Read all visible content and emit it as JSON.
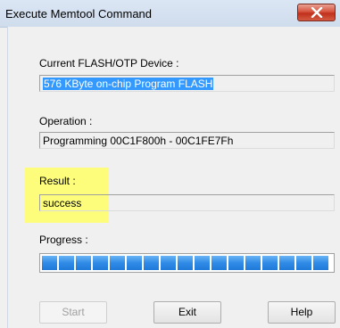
{
  "window": {
    "title": "Execute Memtool Command"
  },
  "device": {
    "label": "Current FLASH/OTP Device :",
    "value": "576 KByte on-chip Program FLASH"
  },
  "operation": {
    "label": "Operation :",
    "value": "Programming 00C1F800h - 00C1FE7Fh"
  },
  "result": {
    "label": "Result :",
    "value": "success"
  },
  "progress": {
    "label": "Progress :",
    "percent": 100,
    "segments": 17
  },
  "buttons": {
    "start": "Start",
    "exit": "Exit",
    "help": "Help"
  },
  "colors": {
    "accent": "#3399ff",
    "highlight": "#ffff66",
    "progress_fill": "#2f8be6"
  }
}
